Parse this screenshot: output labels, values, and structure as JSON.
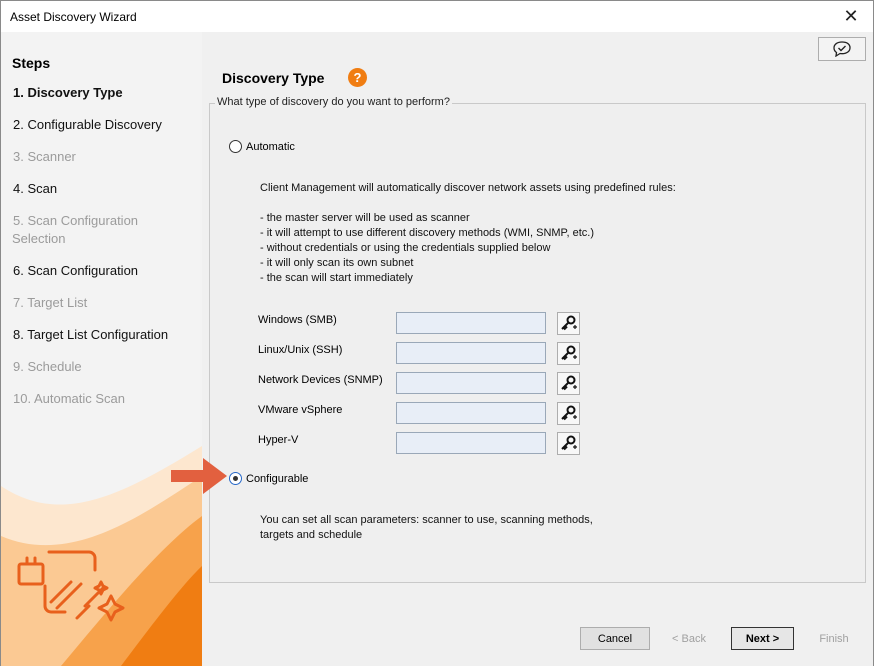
{
  "window": {
    "title": "Asset Discovery Wizard"
  },
  "sidebar": {
    "title": "Steps",
    "steps": [
      {
        "label": "1. Discovery Type",
        "state": "active"
      },
      {
        "label": "2. Configurable Discovery",
        "state": "enabled"
      },
      {
        "label": "3. Scanner",
        "state": "disabled"
      },
      {
        "label": "4. Scan",
        "state": "enabled"
      },
      {
        "label": "5. Scan Configuration",
        "label2": "Selection",
        "state": "disabled"
      },
      {
        "label": "6. Scan Configuration",
        "state": "enabled"
      },
      {
        "label": "7. Target List",
        "state": "disabled"
      },
      {
        "label": "8. Target List Configuration",
        "state": "enabled"
      },
      {
        "label": "9. Schedule",
        "state": "disabled"
      },
      {
        "label": "10. Automatic Scan",
        "state": "disabled"
      }
    ]
  },
  "main": {
    "title": "Discovery Type",
    "help_icon": "?",
    "question": "What type of discovery do you want to perform?",
    "automatic": {
      "label": "Automatic",
      "selected": false,
      "description": "Client Management will automatically discover network assets using predefined rules:",
      "bullets": [
        "- the master server will be used as scanner",
        "- it will attempt to use different discovery methods (WMI, SNMP, etc.)",
        "- without credentials or using the credentials supplied below",
        "- it will only scan its own subnet",
        "- the scan will start immediately"
      ],
      "credentials": [
        {
          "label": "Windows (SMB)",
          "value": ""
        },
        {
          "label": "Linux/Unix (SSH)",
          "value": ""
        },
        {
          "label": "Network Devices (SNMP)",
          "value": ""
        },
        {
          "label": "VMware vSphere",
          "value": ""
        },
        {
          "label": "Hyper-V",
          "value": ""
        }
      ]
    },
    "configurable": {
      "label": "Configurable",
      "selected": true,
      "description1": "You can set all scan parameters: scanner to use, scanning methods,",
      "description2": "targets and schedule"
    }
  },
  "footer": {
    "cancel": "Cancel",
    "back": "< Back",
    "next": "Next >",
    "finish": "Finish"
  },
  "colors": {
    "accent": "#f07d12",
    "arrow": "#e2603f"
  }
}
